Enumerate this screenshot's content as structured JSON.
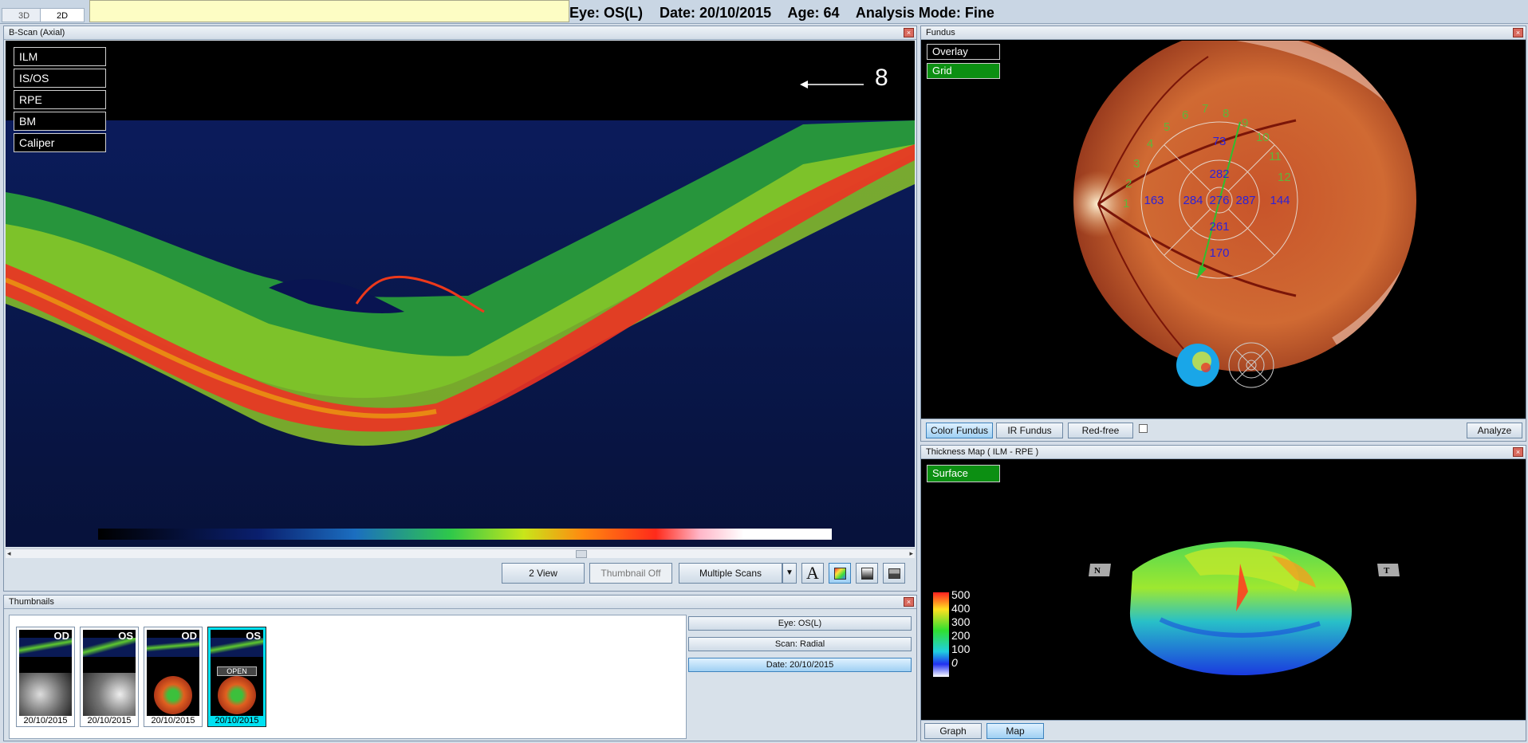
{
  "topbar": {
    "tab_3d": "3D",
    "tab_2d": "2D",
    "eye": "Eye: OS(L)",
    "date": "Date: 20/10/2015",
    "age": "Age: 64",
    "analysis": "Analysis Mode: Fine"
  },
  "bscan": {
    "title": "B-Scan (Axial)",
    "layers": [
      "ILM",
      "IS/OS",
      "RPE",
      "BM",
      "Caliper"
    ],
    "scan_index": "8",
    "buttons": {
      "two_view": "2 View",
      "thumbnail_off": "Thumbnail Off",
      "multiple_scans": "Multiple Scans"
    }
  },
  "fundus": {
    "title": "Fundus",
    "overlay": "Overlay",
    "grid": "Grid",
    "grid_values": {
      "superior_outer": "73",
      "superior_inner": "282",
      "nasal_outer": "163",
      "nasal_inner": "284",
      "center": "276",
      "temporal_inner": "287",
      "temporal_outer": "144",
      "inferior_inner": "261",
      "inferior_outer": "170"
    },
    "clock_numbers": [
      "1",
      "2",
      "3",
      "4",
      "5",
      "6",
      "7",
      "8",
      "9",
      "10",
      "11",
      "12"
    ],
    "buttons": {
      "color_fundus": "Color Fundus",
      "ir_fundus": "IR Fundus",
      "red_free": "Red-free",
      "analyze": "Analyze"
    }
  },
  "thickness": {
    "title": "Thickness Map  ( ILM - RPE )",
    "surface": "Surface",
    "label_n": "N",
    "label_t": "T",
    "scale": [
      "500",
      "400",
      "300",
      "200",
      "100",
      "0"
    ],
    "buttons": {
      "graph": "Graph",
      "map": "Map"
    }
  },
  "thumbnails": {
    "title": "Thumbnails",
    "items": [
      {
        "eye": "OD",
        "date": "20/10/2015"
      },
      {
        "eye": "OS",
        "date": "20/10/2015"
      },
      {
        "eye": "OD",
        "date": "20/10/2015"
      },
      {
        "eye": "OS",
        "date": "20/10/2015",
        "badge": "OPEN"
      }
    ],
    "info": {
      "eye": "Eye: OS(L)",
      "scan": "Scan: Radial",
      "date": "Date: 20/10/2015"
    }
  },
  "colors": {
    "panel_bg": "#000000",
    "green": "#0c8f12",
    "grid_text": "#2d22d8",
    "clock_text": "#5fb63a"
  }
}
